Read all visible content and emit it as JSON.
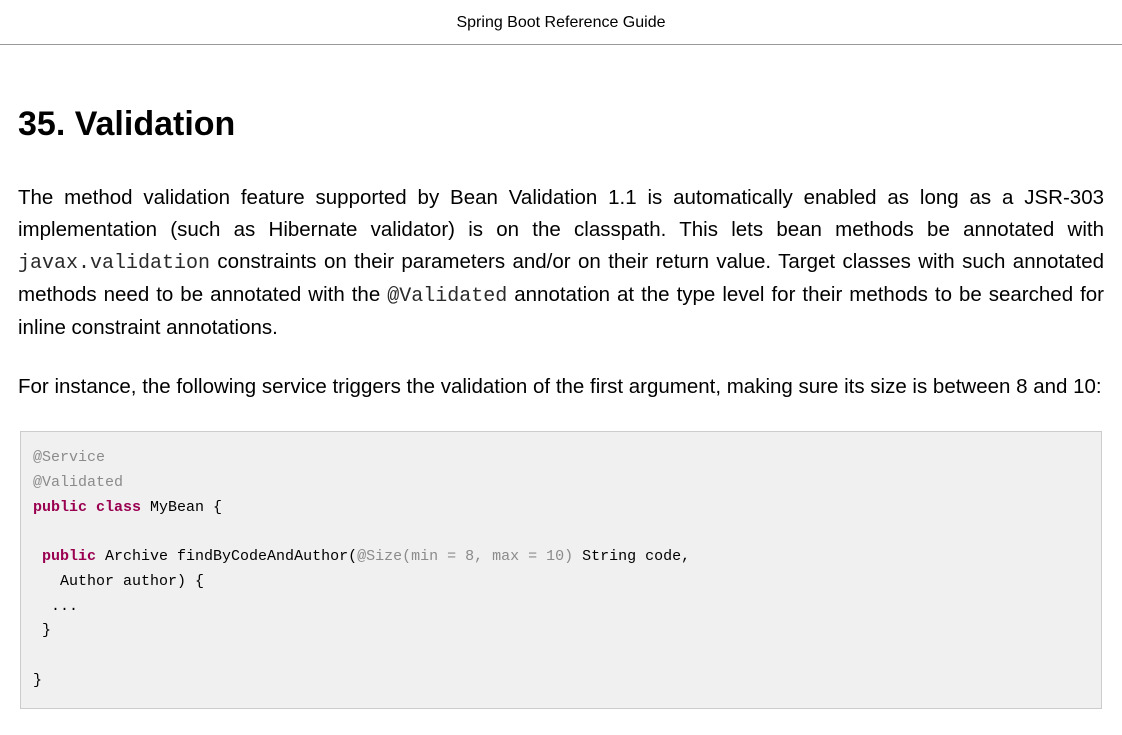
{
  "header": {
    "title": "Spring Boot Reference Guide"
  },
  "section": {
    "heading": "35. Validation",
    "para1_part1": "The method validation feature supported by Bean Validation 1.1 is automatically enabled as long as a JSR-303 implementation (such as Hibernate validator) is on the classpath. This lets bean methods be annotated with ",
    "para1_code1": "javax.validation",
    "para1_part2": " constraints on their parameters and/or on their return value. Target classes with such annotated methods need to be annotated with the ",
    "para1_code2": "@Validated",
    "para1_part3": " annotation at the type level for their methods to be searched for inline constraint annotations.",
    "para2": "For instance, the following service triggers the validation of the first argument, making sure its size is between 8 and 10:"
  },
  "code": {
    "l1_ann": "@Service",
    "l2_ann": "@Validated",
    "l3_kw1": "public",
    "l3_kw2": "class",
    "l3_rest": " MyBean {",
    "l4_indent": " ",
    "l4_kw": "public",
    "l4_plain1": " Archive findByCodeAndAuthor(",
    "l4_ann": "@Size",
    "l4_grey": "(min = 8, max = 10)",
    "l4_plain2": " String code,",
    "l5": "   Author author) {",
    "l6": "  ...",
    "l7": " }",
    "l8": "}"
  }
}
